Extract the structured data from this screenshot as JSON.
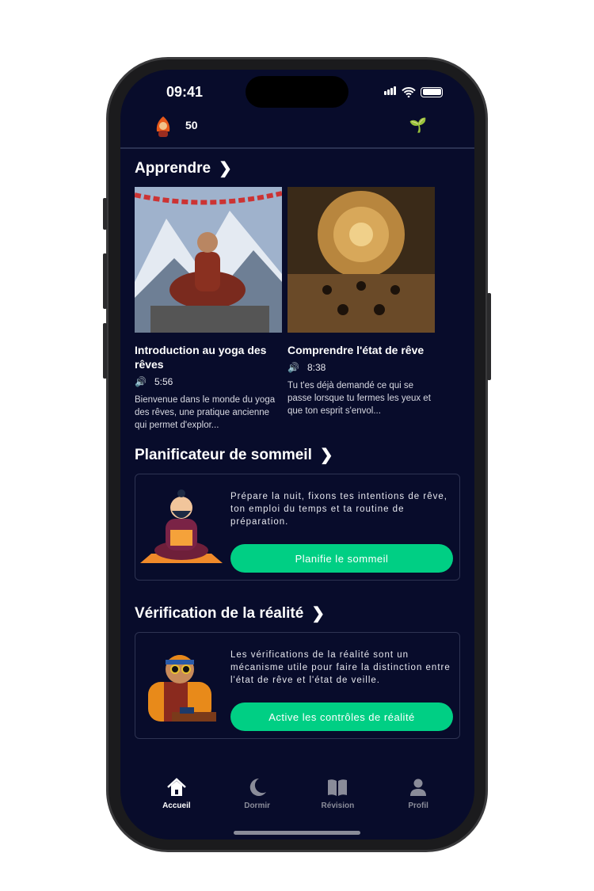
{
  "status_bar": {
    "time": "09:41"
  },
  "header": {
    "points": "50"
  },
  "learn": {
    "title": "Apprendre",
    "cards": [
      {
        "title": "Introduction au yoga des rêves",
        "duration": "5:56",
        "description": "Bienvenue dans le monde du yoga des rêves, une pratique ancienne qui permet d'explor..."
      },
      {
        "title": "Comprendre l'état de rêve",
        "duration": "8:38",
        "description": "Tu t'es déjà demandé ce qui se passe lorsque tu fermes les yeux et que ton esprit s'envol..."
      }
    ]
  },
  "planner": {
    "title": "Planificateur de sommeil",
    "text": "Prépare la nuit, fixons tes intentions de rêve, ton emploi du temps et ta routine de préparation.",
    "button": "Planifie le sommeil"
  },
  "reality": {
    "title": "Vérification de la réalité",
    "text": "Les vérifications de la réalité sont un mécanisme utile pour faire la distinction entre l'état de rêve et l'état de veille.",
    "button": "Active les contrôles de réalité"
  },
  "tabs": [
    {
      "label": "Accueil",
      "icon": "home-icon",
      "active": true
    },
    {
      "label": "Dormir",
      "icon": "moon-icon"
    },
    {
      "label": "Révision",
      "icon": "book-icon"
    },
    {
      "label": "Profil",
      "icon": "person-icon"
    }
  ],
  "colors": {
    "background": "#080c2b",
    "accent": "#00cf84"
  }
}
